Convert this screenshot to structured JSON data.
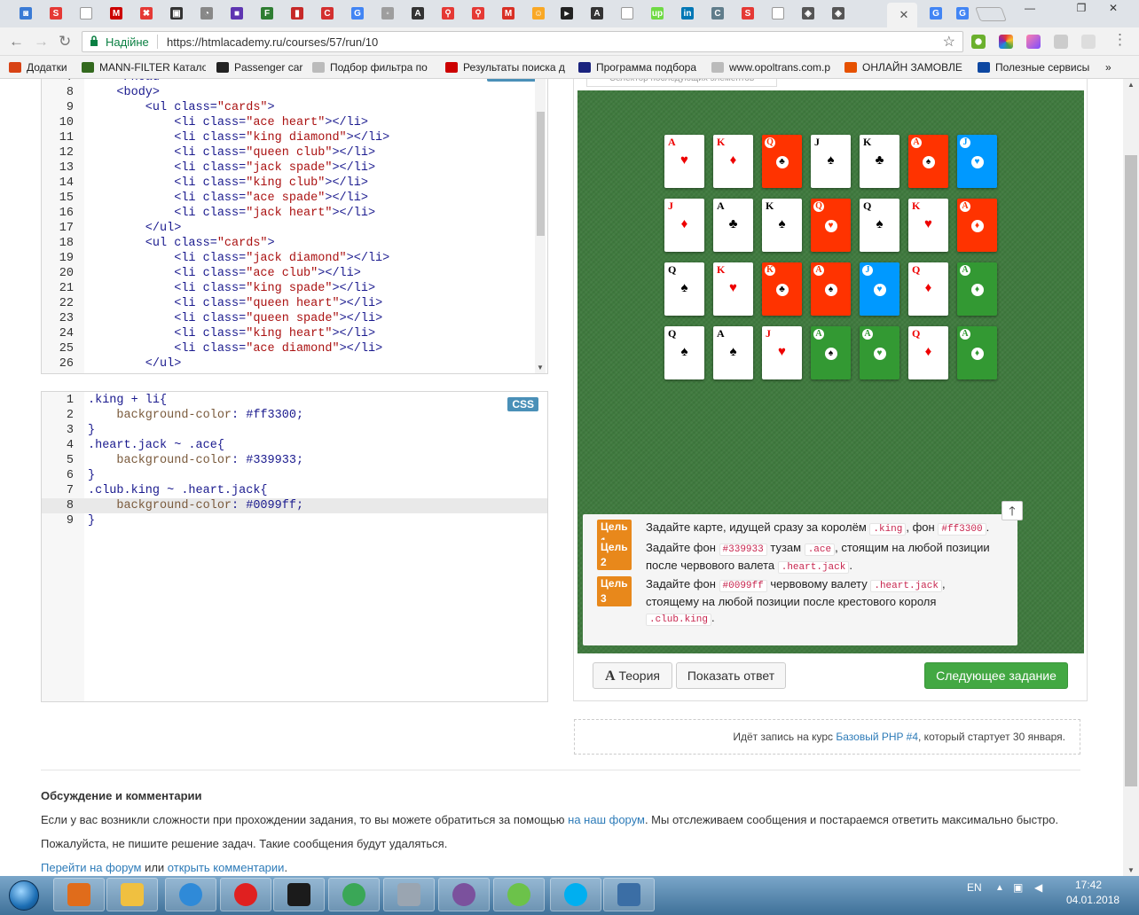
{
  "browser": {
    "tabs": [
      {
        "icon": "generic-favicon-icon",
        "color": "#3a7bd5",
        "glyph": "◙"
      },
      {
        "icon": "s-favicon-icon",
        "color": "#e53935",
        "glyph": "S"
      },
      {
        "icon": "page-favicon-icon",
        "color": "#bbbbbb",
        "glyph": ""
      },
      {
        "icon": "m-favicon-icon",
        "color": "#cc0000",
        "glyph": "M"
      },
      {
        "icon": "x-favicon-icon",
        "color": "#e53935",
        "glyph": "✖"
      },
      {
        "icon": "camera-favicon-icon",
        "color": "#333333",
        "glyph": "▣"
      },
      {
        "icon": "gauge-favicon-icon",
        "color": "#888888",
        "glyph": "◔"
      },
      {
        "icon": "square-favicon-icon",
        "color": "#5e35b1",
        "glyph": "■"
      },
      {
        "icon": "f-favicon-icon",
        "color": "#2e7d32",
        "glyph": "F"
      },
      {
        "icon": "thermo-favicon-icon",
        "color": "#c62828",
        "glyph": "▮"
      },
      {
        "icon": "c-favicon-icon",
        "color": "#d32f2f",
        "glyph": "C"
      },
      {
        "icon": "translate-favicon-icon",
        "color": "#4285f4",
        "glyph": "G"
      },
      {
        "icon": "bulb-favicon-icon",
        "color": "#9e9e9e",
        "glyph": "◦"
      },
      {
        "icon": "a-favicon-icon",
        "color": "#333333",
        "glyph": "A"
      },
      {
        "icon": "figure-favicon-icon",
        "color": "#e53935",
        "glyph": "⚲"
      },
      {
        "icon": "figure2-favicon-icon",
        "color": "#e53935",
        "glyph": "⚲"
      },
      {
        "icon": "gmail-favicon-icon",
        "color": "#d93025",
        "glyph": "M"
      },
      {
        "icon": "smile-favicon-icon",
        "color": "#f9a825",
        "glyph": "☺"
      },
      {
        "icon": "terminal-favicon-icon",
        "color": "#222222",
        "glyph": "▸"
      },
      {
        "icon": "a2-favicon-icon",
        "color": "#333333",
        "glyph": "A"
      },
      {
        "icon": "page2-favicon-icon",
        "color": "#bbbbbb",
        "glyph": ""
      },
      {
        "icon": "up-favicon-icon",
        "color": "#6fda44",
        "glyph": "up"
      },
      {
        "icon": "linkedin-favicon-icon",
        "color": "#0077b5",
        "glyph": "in"
      },
      {
        "icon": "doc-favicon-icon",
        "color": "#607d8b",
        "glyph": "C"
      },
      {
        "icon": "s2-favicon-icon",
        "color": "#e53935",
        "glyph": "S"
      },
      {
        "icon": "page3-favicon-icon",
        "color": "#bbbbbb",
        "glyph": ""
      },
      {
        "icon": "shield-favicon-icon",
        "color": "#555555",
        "glyph": "◈"
      },
      {
        "icon": "shield2-favicon-icon",
        "color": "#555555",
        "glyph": "◈"
      },
      {
        "icon": "htmlacademy-favicon-icon",
        "color": "#f2f2f2",
        "glyph": "",
        "active": true
      },
      {
        "icon": "google-favicon-icon",
        "color": "#4285f4",
        "glyph": "G"
      },
      {
        "icon": "google2-favicon-icon",
        "color": "#4285f4",
        "glyph": "G"
      }
    ],
    "secure_label": "Надійне",
    "url": "https://htmlacademy.ru/courses/57/run/10",
    "bookmarks": [
      {
        "label": "Додатки",
        "color": "#d84315"
      },
      {
        "label": "MANN-FILTER Катало",
        "color": "#33691e"
      },
      {
        "label": "Passenger car",
        "color": "#222222"
      },
      {
        "label": "Подбор фильтра по",
        "color": "#bbbbbb"
      },
      {
        "label": "Результаты поиска д",
        "color": "#cc0000"
      },
      {
        "label": "Программа подбора",
        "color": "#1a237e"
      },
      {
        "label": "www.opoltrans.com.p",
        "color": "#bbbbbb"
      },
      {
        "label": "ОНЛАЙН ЗАМОВЛЕ",
        "color": "#e65100"
      },
      {
        "label": "Полезные сервисы",
        "color": "#0d47a1"
      }
    ]
  },
  "html_editor": {
    "lines": [
      {
        "n": "7",
        "text": "    </head>"
      },
      {
        "n": "8",
        "text": "    <body>"
      },
      {
        "n": "9",
        "text": "        <ul class=\"cards\">"
      },
      {
        "n": "10",
        "text": "            <li class=\"ace heart\"></li>"
      },
      {
        "n": "11",
        "text": "            <li class=\"king diamond\"></li>"
      },
      {
        "n": "12",
        "text": "            <li class=\"queen club\"></li>"
      },
      {
        "n": "13",
        "text": "            <li class=\"jack spade\"></li>"
      },
      {
        "n": "14",
        "text": "            <li class=\"king club\"></li>"
      },
      {
        "n": "15",
        "text": "            <li class=\"ace spade\"></li>"
      },
      {
        "n": "16",
        "text": "            <li class=\"jack heart\"></li>"
      },
      {
        "n": "17",
        "text": "        </ul>"
      },
      {
        "n": "18",
        "text": "        <ul class=\"cards\">"
      },
      {
        "n": "19",
        "text": "            <li class=\"jack diamond\"></li>"
      },
      {
        "n": "20",
        "text": "            <li class=\"ace club\"></li>"
      },
      {
        "n": "21",
        "text": "            <li class=\"king spade\"></li>"
      },
      {
        "n": "22",
        "text": "            <li class=\"queen heart\"></li>"
      },
      {
        "n": "23",
        "text": "            <li class=\"queen spade\"></li>"
      },
      {
        "n": "24",
        "text": "            <li class=\"king heart\"></li>"
      },
      {
        "n": "25",
        "text": "            <li class=\"ace diamond\"></li>"
      },
      {
        "n": "26",
        "text": "        </ul>"
      }
    ]
  },
  "css_editor": {
    "badge": "CSS",
    "lines": [
      {
        "n": "1",
        "text": ".king + li{"
      },
      {
        "n": "2",
        "text": "    background-color: #ff3300;"
      },
      {
        "n": "3",
        "text": "}"
      },
      {
        "n": "4",
        "text": ".heart.jack ~ .ace{"
      },
      {
        "n": "5",
        "text": "    background-color: #339933;"
      },
      {
        "n": "6",
        "text": "}"
      },
      {
        "n": "7",
        "text": ".club.king ~ .heart.jack{"
      },
      {
        "n": "8",
        "text": "    background-color: #0099ff;"
      },
      {
        "n": "9",
        "text": "}"
      }
    ]
  },
  "task_tab_label": "Селектор последующих элементов",
  "cards": [
    [
      {
        "rank": "A",
        "suit": "heart",
        "bg": "white"
      },
      {
        "rank": "K",
        "suit": "diamond",
        "bg": "white"
      },
      {
        "rank": "Q",
        "suit": "club",
        "bg": "red"
      },
      {
        "rank": "J",
        "suit": "spade",
        "bg": "white"
      },
      {
        "rank": "K",
        "suit": "club",
        "bg": "white"
      },
      {
        "rank": "A",
        "suit": "spade",
        "bg": "red"
      },
      {
        "rank": "J",
        "suit": "heart",
        "bg": "blue"
      }
    ],
    [
      {
        "rank": "J",
        "suit": "diamond",
        "bg": "white"
      },
      {
        "rank": "A",
        "suit": "club",
        "bg": "white"
      },
      {
        "rank": "K",
        "suit": "spade",
        "bg": "white"
      },
      {
        "rank": "Q",
        "suit": "heart",
        "bg": "red"
      },
      {
        "rank": "Q",
        "suit": "spade",
        "bg": "white"
      },
      {
        "rank": "K",
        "suit": "heart",
        "bg": "white"
      },
      {
        "rank": "A",
        "suit": "diamond",
        "bg": "red"
      }
    ],
    [
      {
        "rank": "Q",
        "suit": "spade",
        "bg": "white"
      },
      {
        "rank": "K",
        "suit": "heart",
        "bg": "white"
      },
      {
        "rank": "K",
        "suit": "club",
        "bg": "red"
      },
      {
        "rank": "A",
        "suit": "spade",
        "bg": "red"
      },
      {
        "rank": "J",
        "suit": "heart",
        "bg": "blue"
      },
      {
        "rank": "Q",
        "suit": "diamond",
        "bg": "white"
      },
      {
        "rank": "A",
        "suit": "diamond",
        "bg": "green"
      }
    ],
    [
      {
        "rank": "Q",
        "suit": "spade",
        "bg": "white"
      },
      {
        "rank": "A",
        "suit": "spade",
        "bg": "white"
      },
      {
        "rank": "J",
        "suit": "heart",
        "bg": "white"
      },
      {
        "rank": "A",
        "suit": "spade",
        "bg": "green"
      },
      {
        "rank": "A",
        "suit": "heart",
        "bg": "green"
      },
      {
        "rank": "Q",
        "suit": "diamond",
        "bg": "white"
      },
      {
        "rank": "A",
        "suit": "diamond",
        "bg": "green"
      }
    ]
  ],
  "goals": [
    {
      "label": "Цель 1",
      "parts": [
        "Задайте карте, идущей сразу за королём ",
        {
          "code": ".king"
        },
        ", фон ",
        {
          "code": "#ff3300"
        },
        "."
      ]
    },
    {
      "label": "Цель 2",
      "parts": [
        "Задайте фон ",
        {
          "code": "#339933"
        },
        " тузам ",
        {
          "code": ".ace"
        },
        ", стоящим на любой позиции после червового валета ",
        {
          "code": ".heart.jack"
        },
        "."
      ]
    },
    {
      "label": "Цель 3",
      "parts": [
        "Задайте фон ",
        {
          "code": "#0099ff"
        },
        " червовому валету ",
        {
          "code": ".heart.jack"
        },
        ", стоящему на любой позиции после крестового короля ",
        {
          "code": ".club.king"
        },
        "."
      ]
    }
  ],
  "buttons": {
    "theory": "Теория",
    "theory_glyph": "A",
    "show_answer": "Показать ответ",
    "next": "Следующее задание"
  },
  "notice": {
    "before": "Идёт запись на курс ",
    "link": "Базовый PHP #4",
    "after": ", который стартует 30 января."
  },
  "discussion": {
    "title": "Обсуждение и комментарии",
    "p1_before": "Если у вас возникли сложности при прохождении задания, то вы можете обратиться за помощью ",
    "p1_link": "на наш форум",
    "p1_after": ". Мы отслеживаем сообщения и постараемся ответить максимально быстро.",
    "p2": "Пожалуйста, не пишите решение задач. Такие сообщения будут удаляться.",
    "p3_link1": "Перейти на форум",
    "p3_mid": " или ",
    "p3_link2": "открыть комментарии",
    "p3_end": "."
  },
  "taskbar": {
    "apps": [
      {
        "name": "media-player",
        "color": "#e06c1b"
      },
      {
        "name": "explorer",
        "color": "#f0c040"
      },
      {
        "name": "internet-explorer",
        "color": "#2f8ad8"
      },
      {
        "name": "opera",
        "color": "#e02020"
      },
      {
        "name": "webstorm",
        "color": "#1b1b1b"
      },
      {
        "name": "chrome",
        "color": "#3aa757"
      },
      {
        "name": "calculator",
        "color": "#9aa5b1"
      },
      {
        "name": "viber",
        "color": "#7b519d"
      },
      {
        "name": "icq",
        "color": "#6cc24a"
      },
      {
        "name": "skype",
        "color": "#00aff0"
      },
      {
        "name": "network",
        "color": "#3b6ea5"
      }
    ],
    "lang": "EN",
    "time": "17:42",
    "date": "04.01.2018"
  },
  "colors": {
    "red": "#ff3300",
    "green": "#339933",
    "blue": "#0099ff",
    "goal_label": "#e8881b",
    "next_button": "#43a843"
  }
}
